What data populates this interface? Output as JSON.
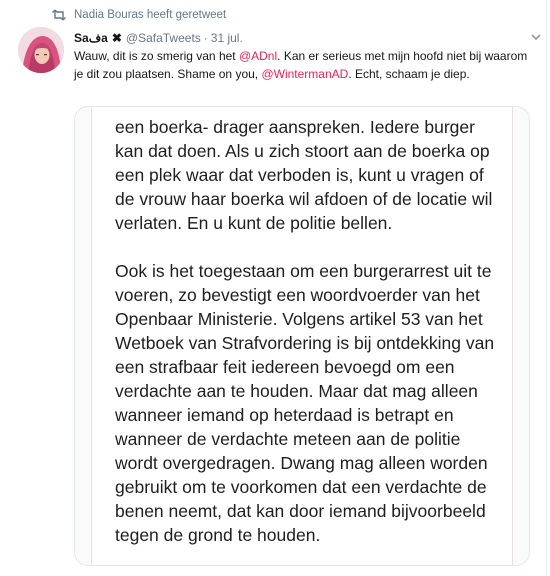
{
  "retweet": {
    "icon": "retweet-icon",
    "label": "Nadia Bouras heeft geretweet"
  },
  "tweet": {
    "display_name": "Saفa",
    "flag_glyph": "✖",
    "handle": "@SafaTweets",
    "separator": "·",
    "date": "31 jul.",
    "text": {
      "part1": "Wauw, dit is zo smerig van het ",
      "mention1": "@ADnl",
      "part2": ". Kan er serieus met mijn hoofd niet bij waarom je dit zou plaatsen. Shame on you, ",
      "mention2": "@WintermanAD",
      "part3": ". Echt, schaam je diep."
    },
    "mention_color": "#e0245e"
  },
  "article": {
    "paragraph1": "een boerka- drager aanspreken. Iedere burger kan dat doen. Als u zich stoort aan de boerka op een plek waar dat verboden is, kunt u vragen of de vrouw haar boerka wil afdoen of de locatie wil verlaten. En u kunt de politie bellen.",
    "paragraph2": "Ook is het toegestaan om een burgerarrest uit te voeren, zo bevestigt een woordvoerder van het Openbaar Ministerie. Volgens artikel 53 van het Wetboek van Strafvordering is bij ontdekking van een strafbaar feit iedereen bevoegd om een verdachte aan te houden. Maar dat mag alleen wanneer iemand op heterdaad is betrapt en wanneer de verdachte meteen aan de politie wordt overgedragen. Dwang mag alleen worden gebruikt om te voorkomen dat een verdachte de benen neemt, dat kan door iemand bijvoorbeeld tegen de grond te houden."
  }
}
